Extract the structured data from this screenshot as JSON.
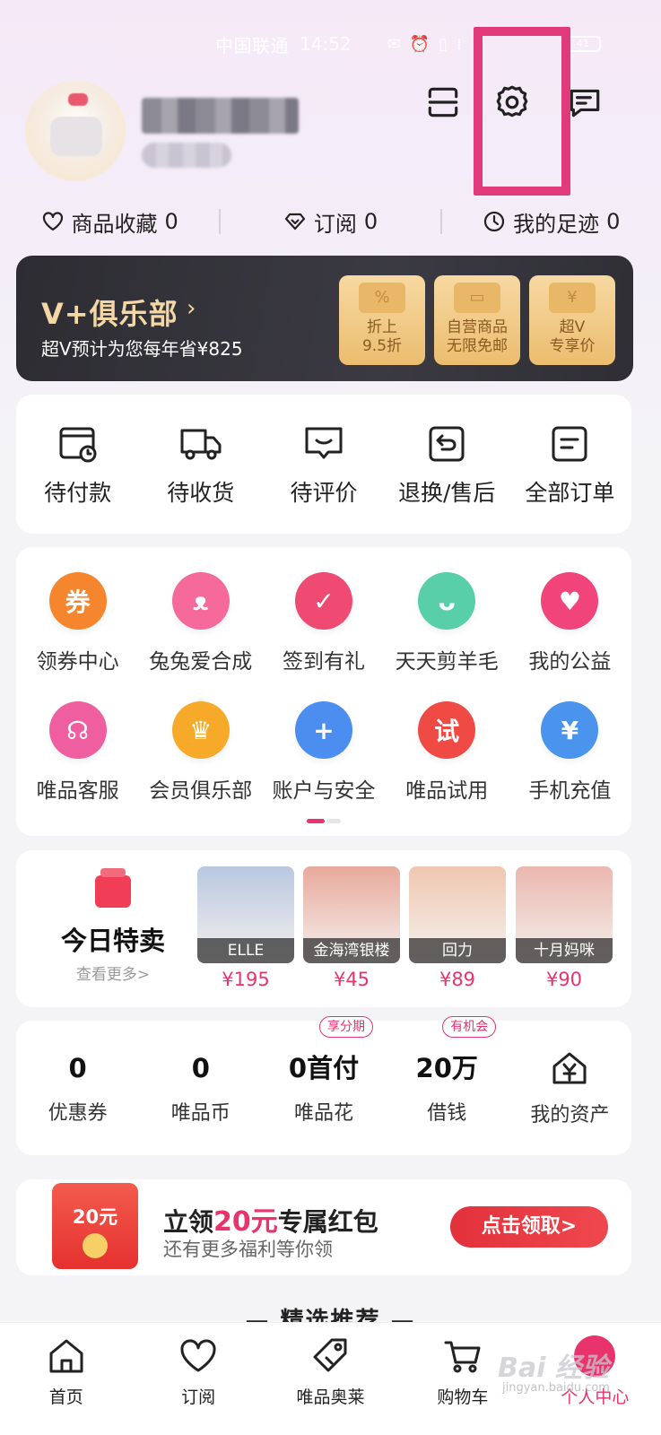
{
  "status_bar": {
    "carrier": "中国联通",
    "time": "14:52",
    "battery": "41"
  },
  "quick_row": [
    {
      "icon": "heart-icon",
      "label": "商品收藏",
      "count": "0"
    },
    {
      "icon": "diamond-icon",
      "label": "订阅",
      "count": "0"
    },
    {
      "icon": "clock-icon",
      "label": "我的足迹",
      "count": "0"
    }
  ],
  "vclub": {
    "title": "V+俱乐部",
    "subtitle": "超V预计为您每年省¥825",
    "cards": [
      {
        "icon": "%",
        "line1": "折上",
        "line2": "9.5折"
      },
      {
        "icon": "▭",
        "line1": "自营商品",
        "line2": "无限免邮"
      },
      {
        "icon": "¥",
        "line1": "超V",
        "line2": "专享价"
      }
    ]
  },
  "orders": [
    {
      "icon": "wallet-clock-icon",
      "label": "待付款"
    },
    {
      "icon": "truck-icon",
      "label": "待收货"
    },
    {
      "icon": "comment-icon",
      "label": "待评价"
    },
    {
      "icon": "return-icon",
      "label": "退换/售后"
    },
    {
      "icon": "list-icon",
      "label": "全部订单"
    }
  ],
  "services": [
    {
      "icon": "coupon-center-icon",
      "glyph": "券",
      "label": "领券中心",
      "color": "#f5862e"
    },
    {
      "icon": "rabbit-icon",
      "glyph": "ᴥ",
      "label": "兔兔爱合成",
      "color": "#f56a9a"
    },
    {
      "icon": "calendar-check-icon",
      "glyph": "✓",
      "label": "签到有礼",
      "color": "#ef4a72"
    },
    {
      "icon": "sheep-icon",
      "glyph": "ᴗ",
      "label": "天天剪羊毛",
      "color": "#58cfa8"
    },
    {
      "icon": "charity-heart-icon",
      "glyph": "♥",
      "label": "我的公益",
      "color": "#f0447a"
    },
    {
      "icon": "headset-icon",
      "glyph": "☊",
      "label": "唯品客服",
      "color": "#ef5fa0"
    },
    {
      "icon": "crown-icon",
      "glyph": "♛",
      "label": "会员俱乐部",
      "color": "#f7a92a"
    },
    {
      "icon": "shield-icon",
      "glyph": "+",
      "label": "账户与安全",
      "color": "#4b8ef0"
    },
    {
      "icon": "trial-icon",
      "glyph": "试",
      "label": "唯品试用",
      "color": "#ef4a43"
    },
    {
      "icon": "phone-recharge-icon",
      "glyph": "¥",
      "label": "手机充值",
      "color": "#4a94ee"
    }
  ],
  "sale": {
    "title": "今日特卖",
    "more": "查看更多>",
    "products": [
      {
        "brand": "ELLE",
        "price": "¥195",
        "color": "#b9c7e0"
      },
      {
        "brand": "金海湾银楼",
        "price": "¥45",
        "color": "#e8a99c"
      },
      {
        "brand": "回力",
        "price": "¥89",
        "color": "#f0c7b1"
      },
      {
        "brand": "十月妈咪",
        "price": "¥90",
        "color": "#eab7ae"
      }
    ]
  },
  "assets": [
    {
      "value": "0",
      "label": "优惠券",
      "pill": ""
    },
    {
      "value": "0",
      "label": "唯品币",
      "pill": ""
    },
    {
      "value": "0首付",
      "label": "唯品花",
      "pill": "享分期"
    },
    {
      "value": "20万",
      "label": "借钱",
      "pill": "有机会"
    },
    {
      "value": "",
      "label": "我的资产",
      "pill": ""
    }
  ],
  "banner": {
    "packet_value": "20元",
    "title_pre": "立领",
    "title_highlight": "20元",
    "title_post": "专属红包",
    "subtitle": "还有更多福利等你领",
    "button": "点击领取>"
  },
  "picks_title": "— 精选推荐 —",
  "bottom_nav": [
    {
      "icon": "home-icon",
      "label": "首页"
    },
    {
      "icon": "heart-icon",
      "label": "订阅"
    },
    {
      "icon": "tag-icon",
      "label": "唯品奥莱"
    },
    {
      "icon": "cart-icon",
      "label": "购物车"
    },
    {
      "icon": "profile-icon",
      "label": "个人中心"
    }
  ],
  "watermark": {
    "text": "Bai 经验",
    "sub": "jingyan.baidu.com"
  }
}
